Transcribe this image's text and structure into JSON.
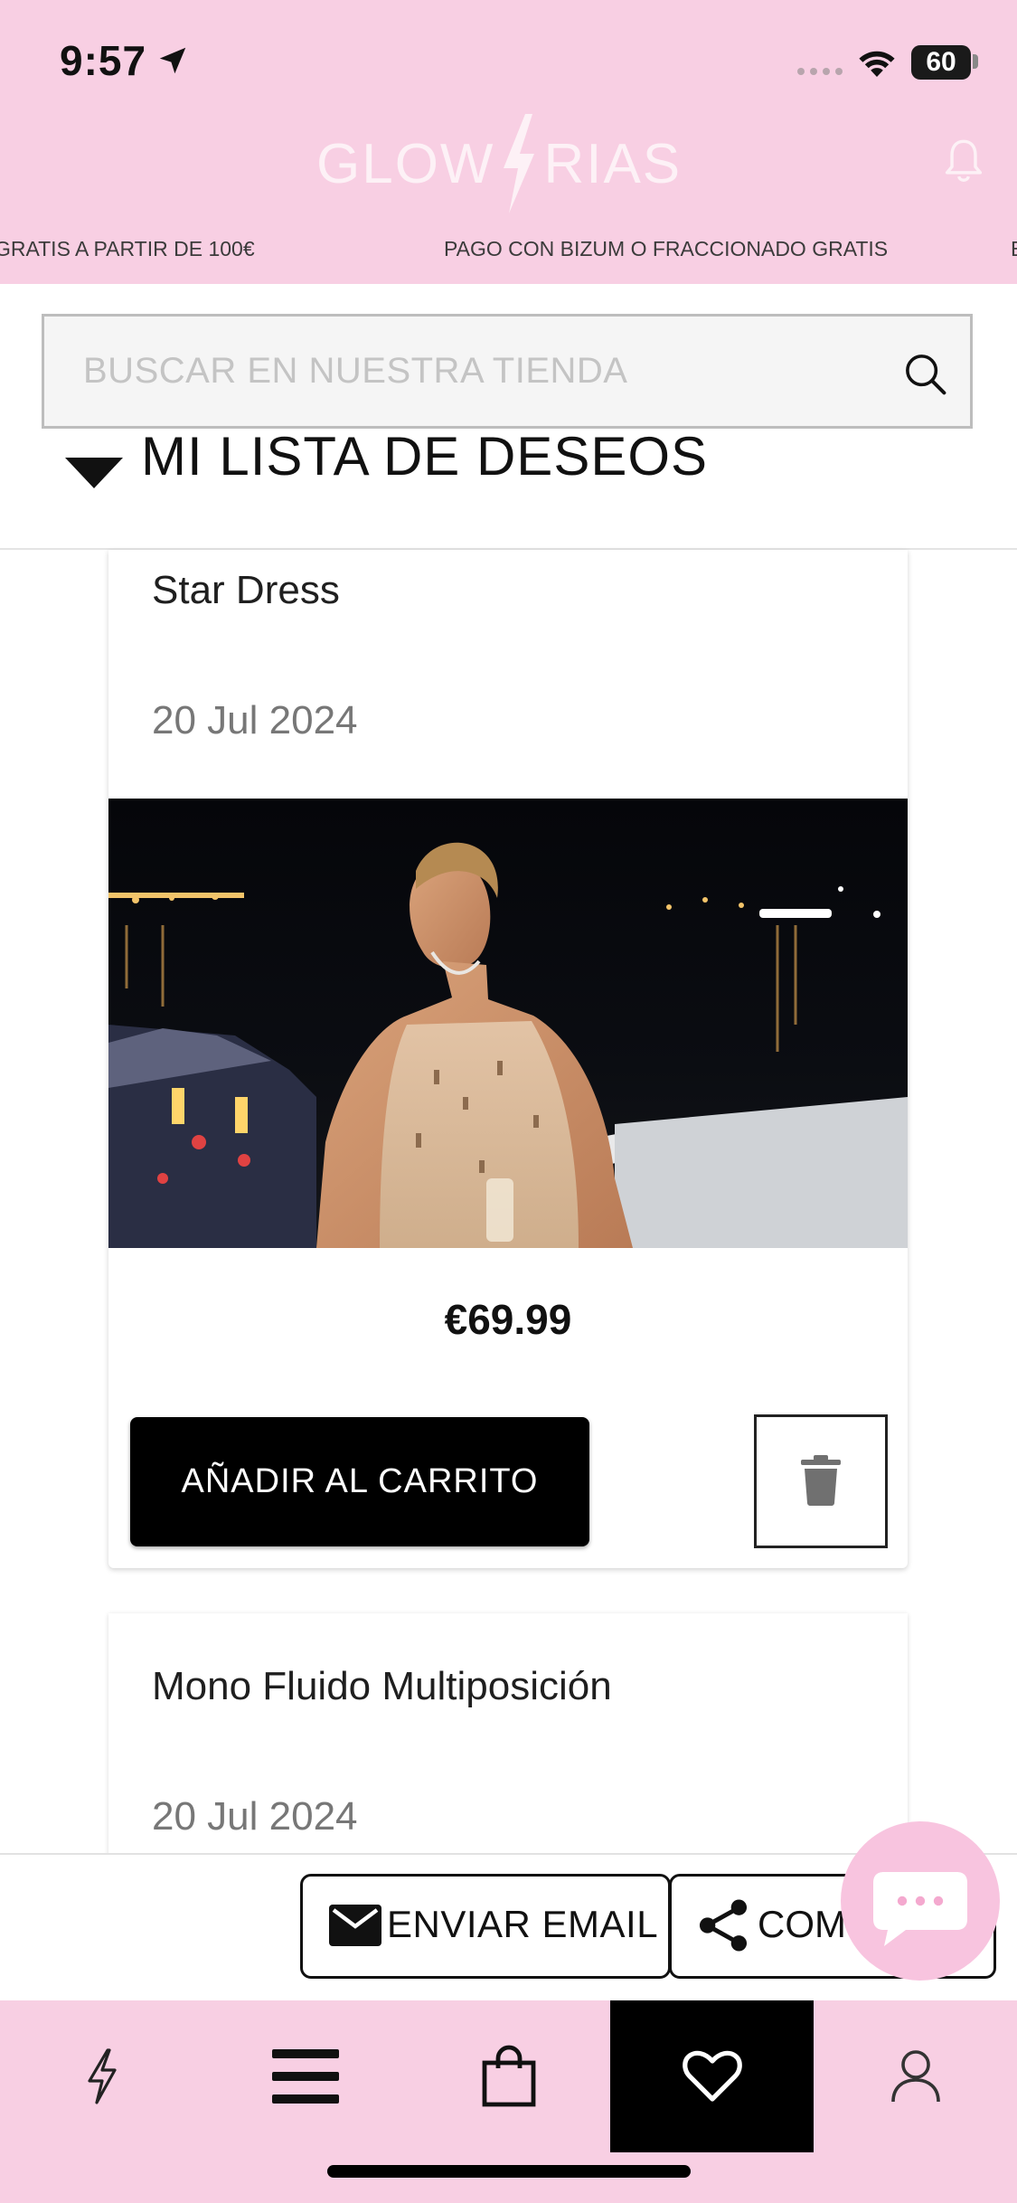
{
  "status_bar": {
    "time": "9:57",
    "battery": "60"
  },
  "header": {
    "logo_left": "GLOW",
    "logo_right": "RIAS",
    "marquee": [
      "GRATIS A PARTIR DE 100€",
      "PAGO CON BIZUM O FRACCIONADO GRATIS",
      "E"
    ]
  },
  "search": {
    "placeholder": "BUSCAR EN NUESTRA TIENDA"
  },
  "wishlist": {
    "title": "MI LISTA DE DESEOS",
    "items": [
      {
        "name": "Star Dress",
        "date": "20 Jul 2024",
        "price": "€69.99",
        "add_to_cart_label": "AÑADIR AL CARRITO"
      },
      {
        "name": "Mono Fluido Multiposición",
        "date": "20 Jul 2024"
      }
    ]
  },
  "share_bar": {
    "email_label": "ENVIAR EMAIL",
    "share_label": "COMPARTIR"
  },
  "bottom_nav": {
    "items": [
      "flash-icon",
      "menu-icon",
      "bag-icon",
      "heart-icon",
      "user-icon"
    ],
    "active": "heart-icon"
  },
  "colors": {
    "brand_pink": "#f8cfe3",
    "chat_pink": "#f8c4df",
    "primary_button": "#000000"
  }
}
